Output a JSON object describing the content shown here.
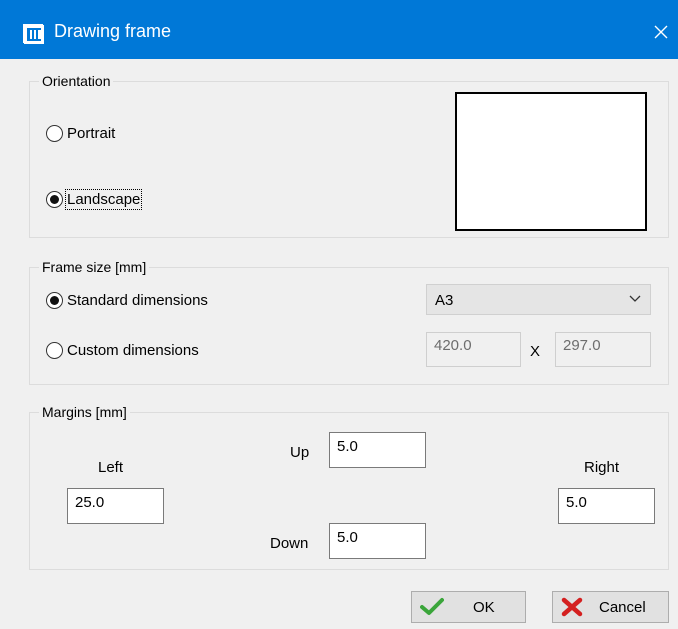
{
  "window": {
    "title": "Drawing frame",
    "app_icon": "frame-icon",
    "close_icon": "close-icon"
  },
  "orientation": {
    "legend": "Orientation",
    "portrait_label": "Portrait",
    "landscape_label": "Landscape",
    "selected": "Landscape"
  },
  "frame_size": {
    "legend": "Frame size [mm]",
    "standard_label": "Standard dimensions",
    "custom_label": "Custom dimensions",
    "selected": "Standard dimensions",
    "size_value": "A3",
    "width_value": "420.0",
    "separator": "X",
    "height_value": "297.0"
  },
  "margins": {
    "legend": "Margins [mm]",
    "left_label": "Left",
    "left_value": "25.0",
    "up_label": "Up",
    "up_value": "5.0",
    "down_label": "Down",
    "down_value": "5.0",
    "right_label": "Right",
    "right_value": "5.0"
  },
  "buttons": {
    "ok_label": "OK",
    "ok_icon": "checkmark-icon",
    "cancel_label": "Cancel",
    "cancel_icon": "red-x-icon"
  },
  "colors": {
    "titlebar": "#0078d7",
    "ok_icon": "#3aa53a",
    "cancel_icon": "#d42020"
  }
}
